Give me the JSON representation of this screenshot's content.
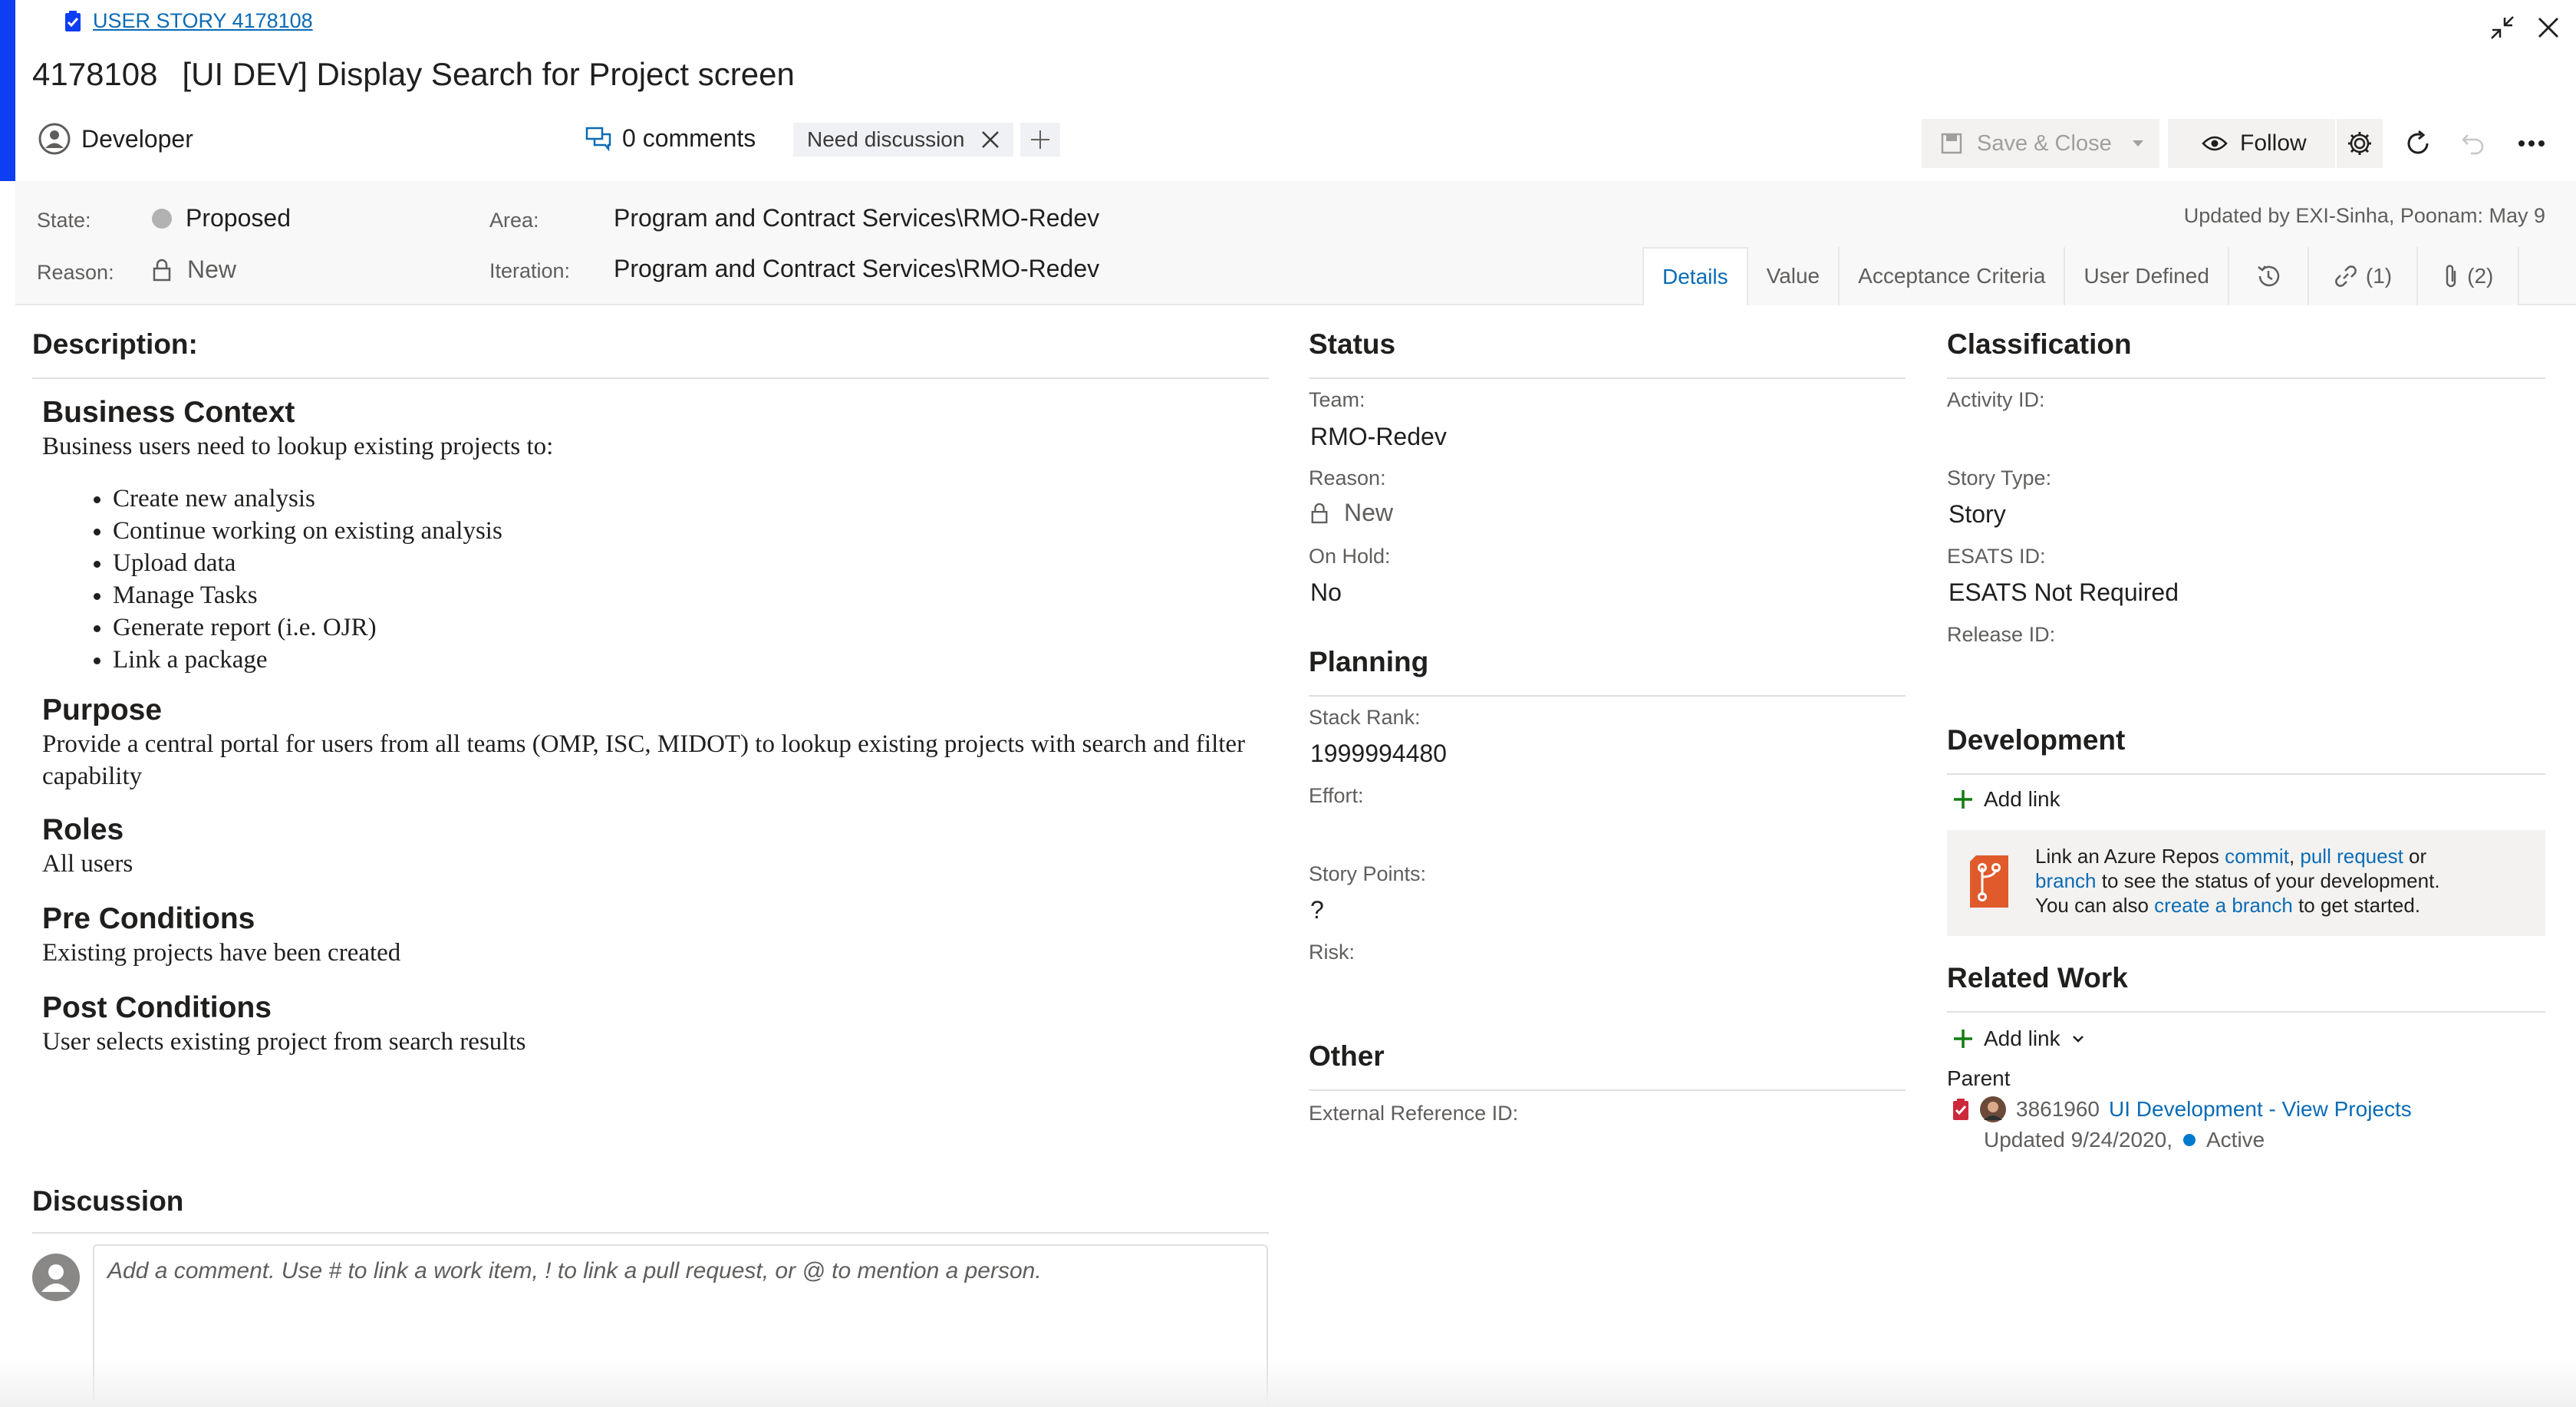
{
  "header": {
    "work_item_link": "USER STORY 4178108",
    "id": "4178108",
    "title": "[UI DEV] Display Search for Project screen",
    "assigned_to": "Developer",
    "comments": "0 comments",
    "tag": "Need discussion"
  },
  "toolbar": {
    "save_close": "Save & Close",
    "follow": "Follow"
  },
  "fields": {
    "state_label": "State:",
    "state_value": "Proposed",
    "reason_label": "Reason:",
    "reason_value": "New",
    "area_label": "Area:",
    "area_value": "Program and Contract Services\\RMO-Redev",
    "iteration_label": "Iteration:",
    "iteration_value": "Program and Contract Services\\RMO-Redev",
    "updated_by": "Updated by EXI-Sinha, Poonam: May 9"
  },
  "tabs": {
    "details": "Details",
    "value": "Value",
    "acceptance": "Acceptance Criteria",
    "user_defined": "User Defined",
    "links_count": "(1)",
    "attachments_count": "(2)"
  },
  "description": {
    "heading": "Description:",
    "business_context_h": "Business Context",
    "business_context_p": "Business users need to lookup existing projects to:",
    "items": [
      "Create new analysis",
      "Continue working on existing analysis",
      "Upload data",
      "Manage Tasks",
      "Generate report (i.e. OJR)",
      "Link a package"
    ],
    "purpose_h": "Purpose",
    "purpose_p": "Provide a central portal for users from all teams (OMP, ISC, MIDOT) to lookup existing projects with search and filter capability",
    "roles_h": "Roles",
    "roles_p": "All users",
    "pre_h": "Pre Conditions",
    "pre_p": "Existing projects have been created",
    "post_h": "Post Conditions",
    "post_p": "User selects existing project from search results"
  },
  "discussion": {
    "heading": "Discussion",
    "placeholder": "Add a comment. Use # to link a work item, ! to link a pull request, or @ to mention a person."
  },
  "status": {
    "heading": "Status",
    "team_label": "Team:",
    "team_value": "RMO-Redev",
    "reason_label": "Reason:",
    "reason_value": "New",
    "onhold_label": "On Hold:",
    "onhold_value": "No"
  },
  "planning": {
    "heading": "Planning",
    "stack_rank_label": "Stack Rank:",
    "stack_rank_value": "1999994480",
    "effort_label": "Effort:",
    "story_points_label": "Story Points:",
    "story_points_value": "?",
    "risk_label": "Risk:"
  },
  "other": {
    "heading": "Other",
    "ext_ref_label": "External Reference ID:"
  },
  "classification": {
    "heading": "Classification",
    "activity_label": "Activity ID:",
    "story_type_label": "Story Type:",
    "story_type_value": "Story",
    "esats_label": "ESATS ID:",
    "esats_value": "ESATS Not Required",
    "release_label": "Release ID:"
  },
  "development": {
    "heading": "Development",
    "add_link": "Add link",
    "text_1": "Link an Azure Repos ",
    "commit": "commit",
    "comma": ", ",
    "pull_request": "pull request",
    "or": " or",
    "branch": "branch",
    "text_2": " to see the status of your development.",
    "text_3": "You can also ",
    "create_branch": "create a branch",
    "text_4": " to get started."
  },
  "related_work": {
    "heading": "Related Work",
    "add_link": "Add link",
    "parent_label": "Parent",
    "parent_id": "3861960",
    "parent_title": "UI Development - View Projects",
    "parent_updated": "Updated 9/24/2020,",
    "parent_state": "Active",
    "state_color": "#007acc"
  },
  "colors": {
    "accent": "#0d3ef2",
    "link": "#0b6bb5",
    "proposed_dot": "#b2b2b2",
    "add_green": "#107c10",
    "repo_orange": "#e05a2b"
  }
}
